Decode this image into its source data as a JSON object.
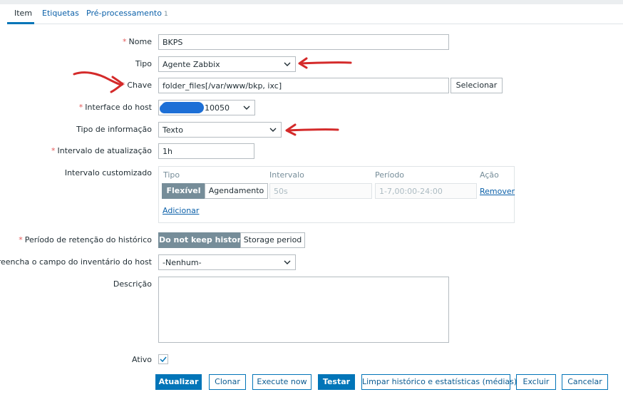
{
  "tabs": [
    {
      "label": "Item"
    },
    {
      "label": "Etiquetas"
    },
    {
      "label": "Pré-processamento",
      "count": "1"
    }
  ],
  "form": {
    "name": {
      "label": "Nome",
      "value": "BKPS"
    },
    "type": {
      "label": "Tipo",
      "value": "Agente Zabbix"
    },
    "key": {
      "label": "Chave",
      "value": "folder_files[/var/www/bkp, ixc]",
      "button": "Selecionar"
    },
    "interface": {
      "label": "Interface do host",
      "value": "10050"
    },
    "info_type": {
      "label": "Tipo de informação",
      "value": "Texto"
    },
    "update_interval": {
      "label": "Intervalo de atualização",
      "value": "1h"
    },
    "custom_intervals": {
      "label": "Intervalo customizado",
      "headers": {
        "type": "Tipo",
        "interval": "Intervalo",
        "period": "Período",
        "action": "Ação"
      },
      "row": {
        "type_options": [
          "Flexível",
          "Agendamento"
        ],
        "interval_placeholder": "50s",
        "period_placeholder": "1-7,00:00-24:00",
        "remove": "Remover"
      },
      "add": "Adicionar"
    },
    "history": {
      "label": "Período de retenção do histórico",
      "options": [
        "Do not keep history",
        "Storage period"
      ]
    },
    "inventory": {
      "label": "Preencha o campo do inventário do host",
      "value": "-Nenhum-"
    },
    "description": {
      "label": "Descrição",
      "value": ""
    },
    "enabled": {
      "label": "Ativo",
      "checked": true
    }
  },
  "actions": {
    "update": "Atualizar",
    "clone": "Clonar",
    "execute": "Execute now",
    "test": "Testar",
    "clear": "Limpar histórico e estatísticas (médias)",
    "delete": "Excluir",
    "cancel": "Cancelar"
  },
  "colors": {
    "accent": "#0275b8",
    "required": "#e45959",
    "annotation": "#d42a2a",
    "redaction": "#1d6fd6"
  }
}
